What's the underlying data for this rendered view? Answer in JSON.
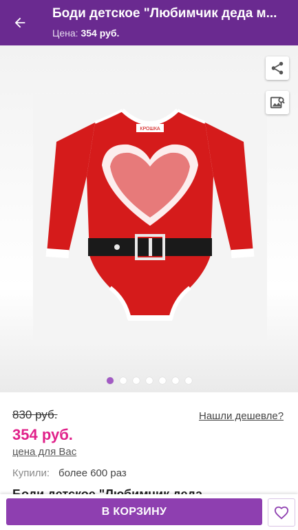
{
  "header": {
    "title": "Боди детское \"Любимчик деда м...",
    "price_label": "Цена:",
    "price_value": "354 руб."
  },
  "gallery": {
    "slide_count": 7,
    "active_index": 0
  },
  "product": {
    "old_price": "830 руб.",
    "price": "354 руб.",
    "price_for_you": "цена для Вас",
    "found_cheaper": "Нашли дешевле?",
    "bought_label": "Купили:",
    "bought_value": "более 600 раз",
    "brand_tag": "КРОШКА",
    "title_cut": "Боди детское \"Любимчик деда"
  },
  "actions": {
    "add_to_cart": "В КОРЗИНУ"
  },
  "colors": {
    "header_bg": "#6a2a90",
    "accent": "#8e3fb0",
    "price": "#e0218a"
  },
  "icons": [
    "back-arrow-icon",
    "share-icon",
    "image-search-icon",
    "heart-icon"
  ]
}
